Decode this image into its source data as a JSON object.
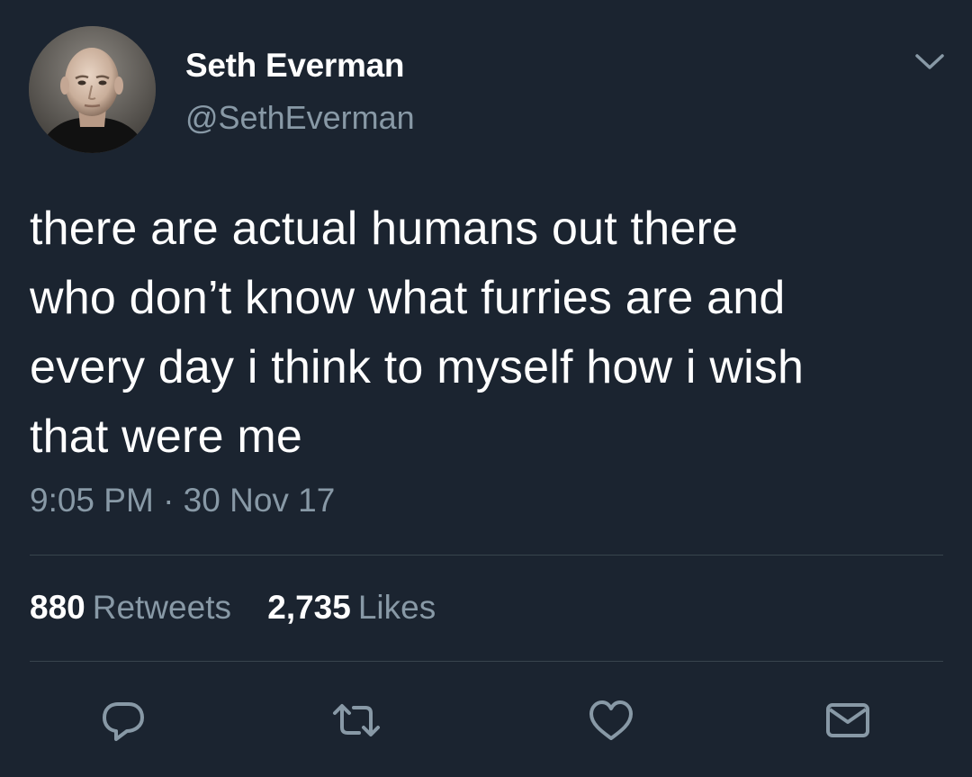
{
  "author": {
    "display_name": "Seth Everman",
    "handle": "@SethEverman",
    "avatar_icon": "profile-photo"
  },
  "tweet": {
    "lines": [
      "there are actual humans out there",
      "who don’t know what furries are and",
      "every day i think to myself how i wish",
      "that were me"
    ],
    "timestamp": "9:05 PM · 30 Nov 17"
  },
  "stats": {
    "retweets": {
      "count": "880",
      "label": "Retweets"
    },
    "likes": {
      "count": "2,735",
      "label": "Likes"
    }
  },
  "actions": [
    {
      "name": "reply",
      "icon": "speech-bubble-icon"
    },
    {
      "name": "retweet",
      "icon": "retweet-arrows-icon"
    },
    {
      "name": "like",
      "icon": "heart-icon"
    },
    {
      "name": "direct-message",
      "icon": "envelope-icon"
    }
  ],
  "colors": {
    "background": "#1b2430",
    "text_primary": "#ffffff",
    "text_secondary": "#8899a6",
    "divider": "#38444d"
  }
}
